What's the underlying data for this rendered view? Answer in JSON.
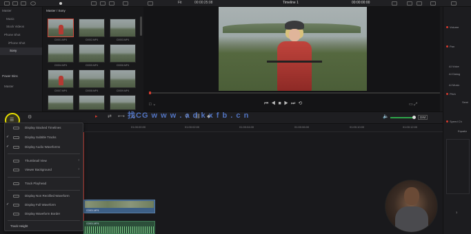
{
  "topbar": {
    "timecode": "00:00:25:08",
    "fit": "Fit",
    "timeline_name": "Timeline 1",
    "right_timecode": "00:00:00:00"
  },
  "sidebar": {
    "items": [
      "Master",
      "Music",
      "Stock Videos",
      "Phone Shot",
      "iPhone Shot",
      "Sony"
    ],
    "power_bins": "Power Bins",
    "power_master": "Master"
  },
  "media": {
    "path": "Master / Sony",
    "thumbs": [
      "C0001.MP4",
      "C0002.MP4",
      "C0003.MP4",
      "C0004.MP4",
      "C0005.MP4",
      "C0006.MP4",
      "C0007.MP4",
      "C0008.MP4",
      "C0009.MP4"
    ]
  },
  "inspector": {
    "items": [
      "Volume",
      "Pan",
      "AI Voice",
      "AI Dialog",
      "AI Music",
      "Pitch",
      "Semi",
      "Speed Ch",
      "Equaliz"
    ],
    "value": "1"
  },
  "toolbar": {
    "dim": "DIM"
  },
  "ruler": {
    "ticks": [
      "01:00:00:00",
      "01:00:02:00",
      "01:00:04:00",
      "01:00:06:00",
      "01:00:10:00",
      "01:00:12:00"
    ]
  },
  "menu": {
    "items": [
      {
        "label": "Display Stacked Timelines",
        "checked": false
      },
      {
        "label": "Display Subtitle Tracks",
        "checked": true
      },
      {
        "label": "Display Audio Waveforms",
        "checked": true
      },
      {
        "label": "Thumbnail View",
        "checked": false
      },
      {
        "label": "Viewer Background",
        "checked": false
      },
      {
        "label": "Track Playhead",
        "checked": false
      },
      {
        "label": "Display Non Rectified Waveform",
        "checked": false
      },
      {
        "label": "Display Full Waveform",
        "checked": true
      },
      {
        "label": "Display Waveform Border",
        "checked": false
      }
    ],
    "track_height": "Track Height"
  },
  "clips": {
    "video": "C0001.MP4",
    "audio": "C0001.MP4"
  },
  "watermark": "找CG  w w w . a d k x f b . c n",
  "colors": {
    "accent_red": "#d43a2e",
    "clip_video": "#3d5f86",
    "clip_audio": "#2c4f3a"
  }
}
